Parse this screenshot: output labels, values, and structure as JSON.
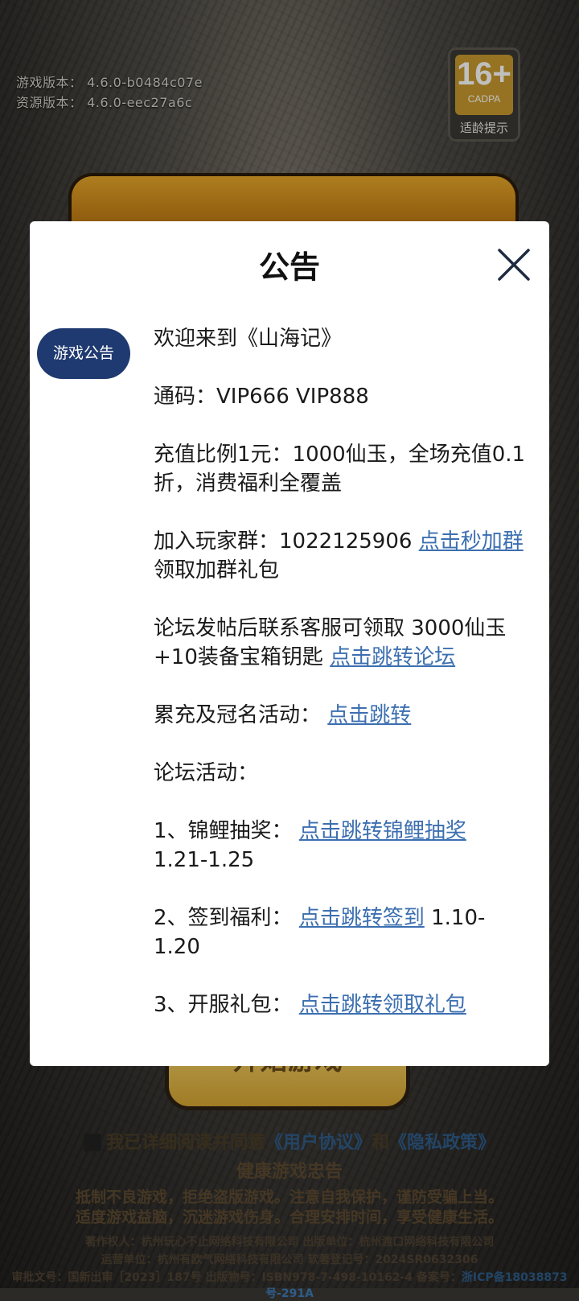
{
  "background": {
    "game_version": "游戏版本：  4.6.0-b0484c07e",
    "resource_version": "资源版本：  4.6.0-eec27a6c",
    "age_rating": {
      "number": "16+",
      "org": "CADPA",
      "tip": "适龄提示",
      "color": "#c89a2e"
    },
    "start_button": "开始游戏",
    "agreement": {
      "checkbox_text": "我已详细阅读并同意",
      "user_agreement": "《用户协议》",
      "and": "和",
      "privacy_policy": "《隐私政策》"
    },
    "health": {
      "title": "健康游戏忠告",
      "line1": "抵制不良游戏，拒绝盗版游戏。注意自我保护，谨防受骗上当。",
      "line2": "适度游戏益脑，沉迷游戏伤身。合理安排时间，享受健康生活。"
    },
    "copyright": {
      "line1": "著作权人：杭州玩心不止网络科技有限公司  出版单位：杭州渡口网络科技有限公司",
      "line2": "运营单位：杭州有欧气网络科技有限公司  软著登记号：2024SR0632306",
      "line3_prefix": "审批文号：国新出审［2023］187号 出版物号：ISBN978-7-498-10162-4 备案号：",
      "line3_icp": "浙ICP备18038873号-291A"
    }
  },
  "dialog": {
    "title": "公告",
    "tab_label": "游戏公告",
    "accent_color": "#1f3a70",
    "link_color": "#3c6fb0",
    "content": {
      "welcome": "欢迎来到《山海记》",
      "code": "通码：VIP666 VIP888",
      "recharge": "充值比例1元：1000仙玉，全场充值0.1折，消费福利全覆盖",
      "group_prefix": "加入玩家群：1022125906 ",
      "group_link": "点击秒加群",
      "group_suffix": "领取加群礼包",
      "forum_prefix": "论坛发帖后联系客服可领取 3000仙玉+10装备宝箱钥匙 ",
      "forum_link": "点击跳转论坛",
      "cumulative_prefix": "累充及冠名活动：  ",
      "cumulative_link": "点击跳转",
      "forum_events": "论坛活动：",
      "item1_prefix": "1、锦鲤抽奖：  ",
      "item1_link": "点击跳转锦鲤抽奖",
      "item1_suffix": "1.21-1.25",
      "item2_prefix": "2、签到福利：  ",
      "item2_link": "点击跳转签到",
      "item2_suffix": " 1.10-1.20",
      "item3_prefix": "3、开服礼包：  ",
      "item3_link": "点击跳转领取礼包"
    }
  }
}
